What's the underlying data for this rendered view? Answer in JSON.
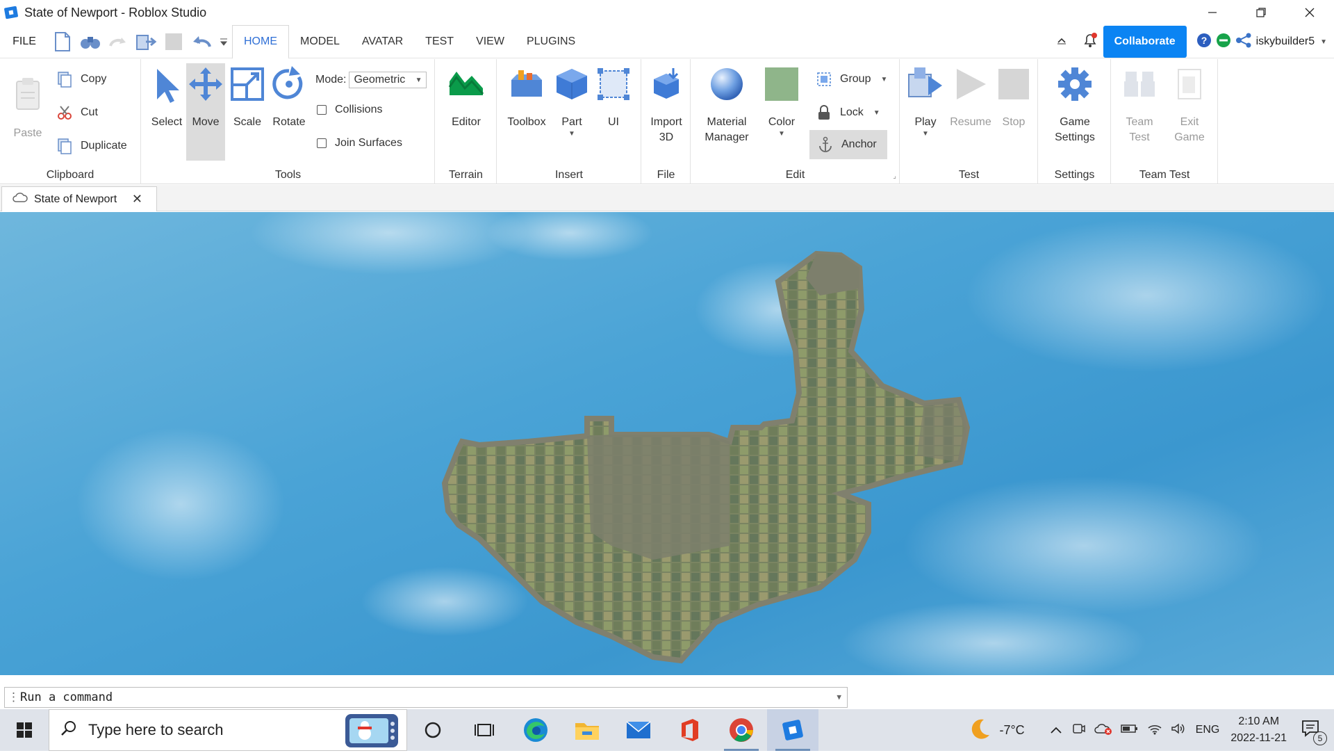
{
  "window": {
    "title": "State of Newport  - Roblox Studio"
  },
  "menu": {
    "file_label": "FILE",
    "tabs": [
      {
        "label": "HOME",
        "active": true
      },
      {
        "label": "MODEL",
        "active": false
      },
      {
        "label": "AVATAR",
        "active": false
      },
      {
        "label": "TEST",
        "active": false
      },
      {
        "label": "VIEW",
        "active": false
      },
      {
        "label": "PLUGINS",
        "active": false
      }
    ],
    "collaborate_label": "Collaborate",
    "username": "iskybuilder5"
  },
  "ribbon": {
    "clipboard": {
      "label": "Clipboard",
      "paste": "Paste",
      "copy": "Copy",
      "cut": "Cut",
      "duplicate": "Duplicate"
    },
    "tools": {
      "label": "Tools",
      "select": "Select",
      "move": "Move",
      "scale": "Scale",
      "rotate": "Rotate",
      "mode_label": "Mode:",
      "mode_value": "Geometric",
      "collisions": "Collisions",
      "join_surfaces": "Join Surfaces"
    },
    "terrain": {
      "label": "Terrain",
      "editor": "Editor"
    },
    "insert": {
      "label": "Insert",
      "toolbox": "Toolbox",
      "part": "Part",
      "ui": "UI"
    },
    "file": {
      "label": "File",
      "import_line1": "Import",
      "import_line2": "3D"
    },
    "edit": {
      "label": "Edit",
      "material_line1": "Material",
      "material_line2": "Manager",
      "color": "Color",
      "group": "Group",
      "lock": "Lock",
      "anchor": "Anchor"
    },
    "test": {
      "label": "Test",
      "play": "Play",
      "resume": "Resume",
      "stop": "Stop"
    },
    "settings": {
      "label": "Settings",
      "game_line1": "Game",
      "game_line2": "Settings"
    },
    "team_test": {
      "label": "Team Test",
      "team_line1": "Team",
      "team_line2": "Test",
      "exit_line1": "Exit",
      "exit_line2": "Game"
    }
  },
  "document": {
    "tab_label": "State of Newport"
  },
  "command": {
    "placeholder": "Run a command"
  },
  "taskbar": {
    "search_placeholder": "Type here to search",
    "weather": "-7°C",
    "language": "ENG",
    "time": "2:10 AM",
    "date": "2022-11-21",
    "notification_count": "5"
  },
  "colors": {
    "accent": "#2f6fd6",
    "collaborate": "#0b84f3",
    "sky": "#4aa3d6",
    "terrain": "#7d7f6c"
  }
}
